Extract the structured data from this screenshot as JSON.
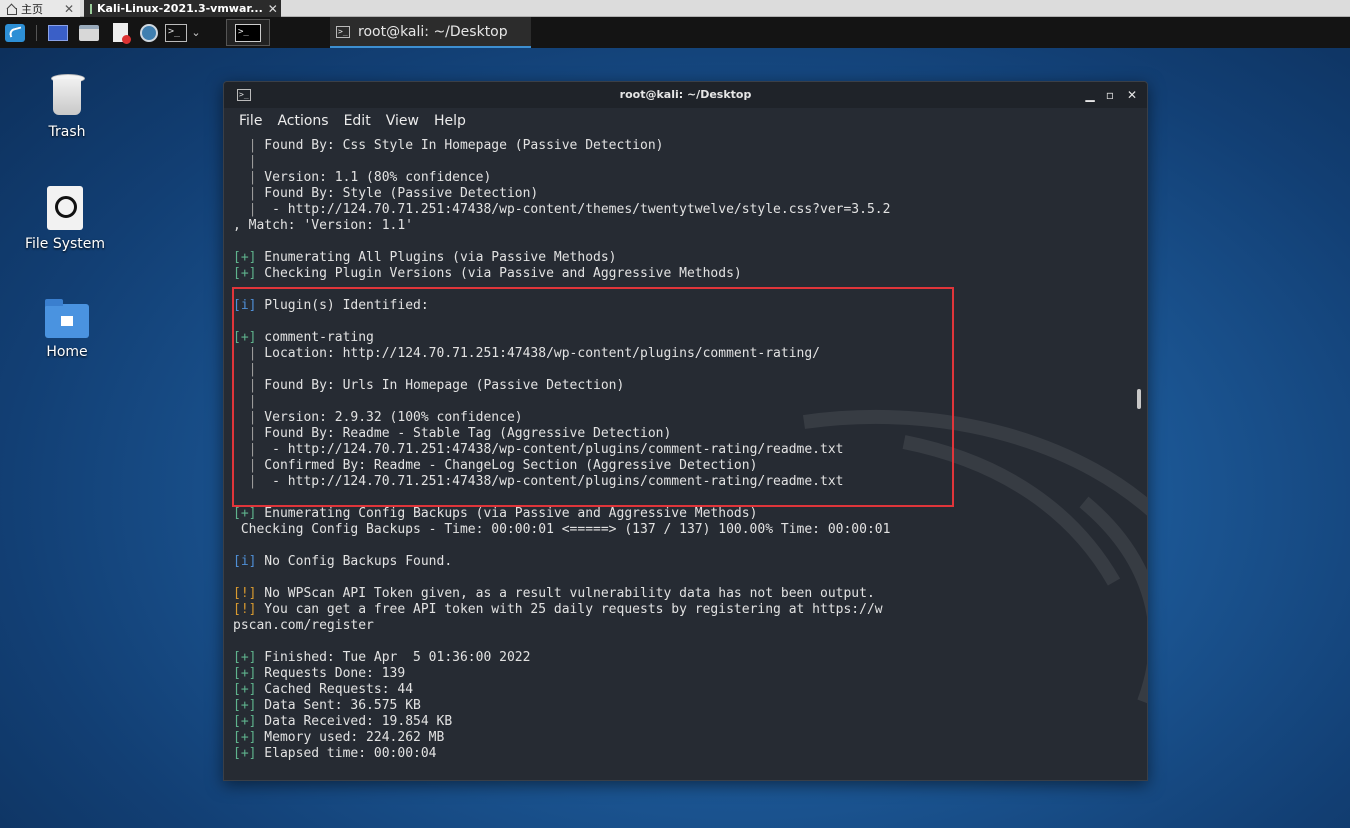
{
  "host_tabs": {
    "home_label": "主页",
    "vm_label": "Kali-Linux-2021.3-vmwar..."
  },
  "panel": {
    "taskbar_title": "root@kali: ~/Desktop"
  },
  "desktop_icons": [
    {
      "label": "Trash"
    },
    {
      "label": "File System"
    },
    {
      "label": "Home"
    }
  ],
  "terminal": {
    "title": "root@kali: ~/Desktop",
    "menu": [
      "File",
      "Actions",
      "Edit",
      "View",
      "Help"
    ],
    "lines": [
      [
        {
          "t": "  "
        },
        {
          "t": "|",
          "c": "bar"
        },
        {
          "t": " Found By: Css Style In Homepage (Passive Detection)"
        }
      ],
      [
        {
          "t": "  "
        },
        {
          "t": "|",
          "c": "bar"
        }
      ],
      [
        {
          "t": "  "
        },
        {
          "t": "|",
          "c": "bar"
        },
        {
          "t": " Version: 1.1 (80% confidence)"
        }
      ],
      [
        {
          "t": "  "
        },
        {
          "t": "|",
          "c": "bar"
        },
        {
          "t": " Found By: Style (Passive Detection)"
        }
      ],
      [
        {
          "t": "  "
        },
        {
          "t": "|",
          "c": "bar"
        },
        {
          "t": "  - http://124.70.71.251:47438/wp-content/themes/twentytwelve/style.css?ver=3.5.2"
        }
      ],
      [
        {
          "t": ", Match: 'Version: 1.1'"
        }
      ],
      [
        {
          "t": ""
        }
      ],
      [
        {
          "t": "[+]",
          "c": "g"
        },
        {
          "t": " Enumerating All Plugins (via Passive Methods)"
        }
      ],
      [
        {
          "t": "[+]",
          "c": "g"
        },
        {
          "t": " Checking Plugin Versions (via Passive and Aggressive Methods)"
        }
      ],
      [
        {
          "t": ""
        }
      ],
      [
        {
          "t": "[i]",
          "c": "b"
        },
        {
          "t": " Plugin(s) Identified:"
        }
      ],
      [
        {
          "t": ""
        }
      ],
      [
        {
          "t": "[+]",
          "c": "g"
        },
        {
          "t": " comment-rating"
        }
      ],
      [
        {
          "t": "  "
        },
        {
          "t": "|",
          "c": "bar"
        },
        {
          "t": " Location: http://124.70.71.251:47438/wp-content/plugins/comment-rating/"
        }
      ],
      [
        {
          "t": "  "
        },
        {
          "t": "|",
          "c": "bar"
        }
      ],
      [
        {
          "t": "  "
        },
        {
          "t": "|",
          "c": "bar"
        },
        {
          "t": " Found By: Urls In Homepage (Passive Detection)"
        }
      ],
      [
        {
          "t": "  "
        },
        {
          "t": "|",
          "c": "bar"
        }
      ],
      [
        {
          "t": "  "
        },
        {
          "t": "|",
          "c": "bar"
        },
        {
          "t": " Version: 2.9.32 (100% confidence)"
        }
      ],
      [
        {
          "t": "  "
        },
        {
          "t": "|",
          "c": "bar"
        },
        {
          "t": " Found By: Readme - Stable Tag (Aggressive Detection)"
        }
      ],
      [
        {
          "t": "  "
        },
        {
          "t": "|",
          "c": "bar"
        },
        {
          "t": "  - http://124.70.71.251:47438/wp-content/plugins/comment-rating/readme.txt"
        }
      ],
      [
        {
          "t": "  "
        },
        {
          "t": "|",
          "c": "bar"
        },
        {
          "t": " Confirmed By: Readme - ChangeLog Section (Aggressive Detection)"
        }
      ],
      [
        {
          "t": "  "
        },
        {
          "t": "|",
          "c": "bar"
        },
        {
          "t": "  - http://124.70.71.251:47438/wp-content/plugins/comment-rating/readme.txt"
        }
      ],
      [
        {
          "t": ""
        }
      ],
      [
        {
          "t": "[+]",
          "c": "g"
        },
        {
          "t": " Enumerating Config Backups (via Passive and Aggressive Methods)"
        }
      ],
      [
        {
          "t": " Checking Config Backups - Time: 00:00:01 <=====> (137 / 137) 100.00% Time: 00:00:01"
        }
      ],
      [
        {
          "t": ""
        }
      ],
      [
        {
          "t": "[i]",
          "c": "b"
        },
        {
          "t": " No Config Backups Found."
        }
      ],
      [
        {
          "t": ""
        }
      ],
      [
        {
          "t": "[!]",
          "c": "o"
        },
        {
          "t": " No WPScan API Token given, as a result vulnerability data has not been output."
        }
      ],
      [
        {
          "t": "[!]",
          "c": "o"
        },
        {
          "t": " You can get a free API token with 25 daily requests by registering at https://w"
        }
      ],
      [
        {
          "t": "pscan.com/register"
        }
      ],
      [
        {
          "t": ""
        }
      ],
      [
        {
          "t": "[+]",
          "c": "g"
        },
        {
          "t": " Finished: Tue Apr  5 01:36:00 2022"
        }
      ],
      [
        {
          "t": "[+]",
          "c": "g"
        },
        {
          "t": " Requests Done: 139"
        }
      ],
      [
        {
          "t": "[+]",
          "c": "g"
        },
        {
          "t": " Cached Requests: 44"
        }
      ],
      [
        {
          "t": "[+]",
          "c": "g"
        },
        {
          "t": " Data Sent: 36.575 KB"
        }
      ],
      [
        {
          "t": "[+]",
          "c": "g"
        },
        {
          "t": " Data Received: 19.854 KB"
        }
      ],
      [
        {
          "t": "[+]",
          "c": "g"
        },
        {
          "t": " Memory used: 224.262 MB"
        }
      ],
      [
        {
          "t": "[+]",
          "c": "g"
        },
        {
          "t": " Elapsed time: 00:00:04"
        }
      ]
    ]
  },
  "colors": {
    "highlight_box": "#e0353a",
    "prompt_plus": "#5fb38d",
    "prompt_info": "#4f8fd6",
    "prompt_warn": "#d89a30"
  }
}
